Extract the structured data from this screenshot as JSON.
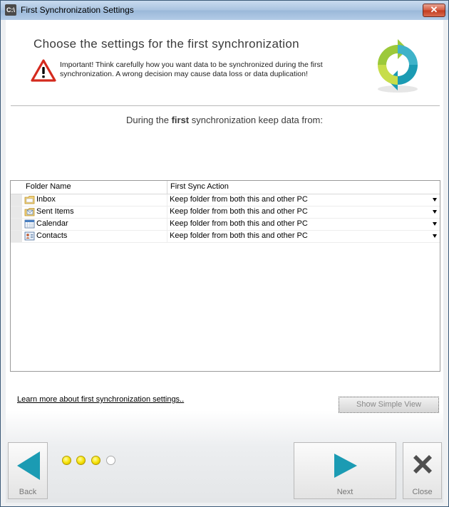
{
  "window": {
    "title": "First Synchronization Settings",
    "icon_label": "C:\\",
    "close_label": "✕"
  },
  "header": {
    "heading": "Choose the settings for the first synchronization",
    "warning": "Important! Think carefully how you want data to be synchronized during the first synchronization. A wrong decision may cause data loss or data duplication!",
    "subtitle_before": "During the ",
    "subtitle_bold": "first",
    "subtitle_after": " synchronization keep data from:"
  },
  "grid": {
    "columns": [
      "Folder Name",
      "First Sync Action"
    ],
    "rows": [
      {
        "name": "Inbox",
        "icon": "inbox-folder-icon",
        "action": "Keep folder from both this and other PC"
      },
      {
        "name": "Sent Items",
        "icon": "sent-items-folder-icon",
        "action": "Keep folder from both this and other PC"
      },
      {
        "name": "Calendar",
        "icon": "calendar-icon",
        "action": "Keep folder from both this and other PC"
      },
      {
        "name": "Contacts",
        "icon": "contacts-icon",
        "action": "Keep folder from both this and other PC"
      }
    ]
  },
  "footer": {
    "learn_more": "Learn more about first synchronization settings..",
    "simple_view": "Show Simple View",
    "back": "Back",
    "next": "Next",
    "close": "Close",
    "progress": {
      "total_steps": 4,
      "filled_steps": 3
    }
  },
  "colors": {
    "accent_teal": "#1b9bb3",
    "progress_yellow": "#f5e100",
    "warning_red": "#d42a1e"
  }
}
